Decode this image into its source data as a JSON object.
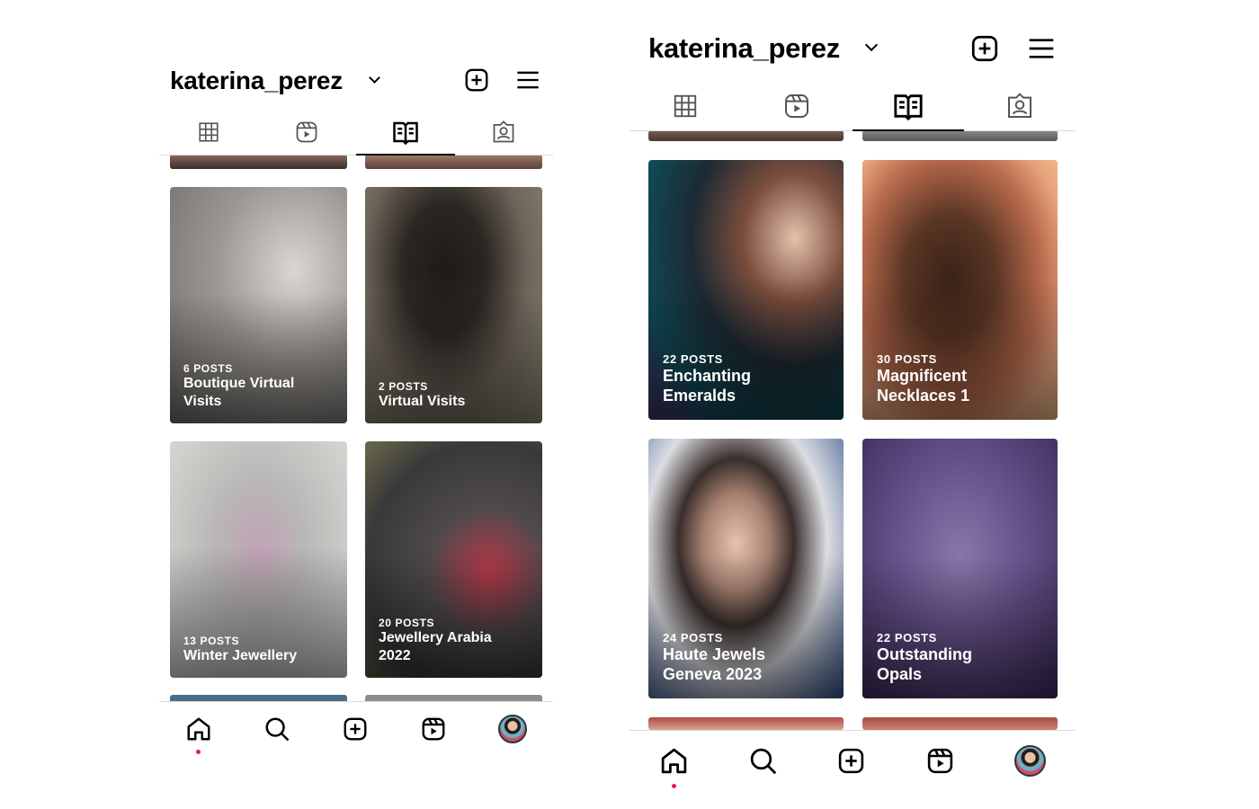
{
  "left": {
    "username": "katerina_perez",
    "active_tab": "guides",
    "guides": [
      {
        "count": "6 POSTS",
        "title": "Boutique Virtual Visits"
      },
      {
        "count": "2 POSTS",
        "title": "Virtual Visits"
      },
      {
        "count": "13 POSTS",
        "title": "Winter Jewellery"
      },
      {
        "count": "20 POSTS",
        "title": "Jewellery Arabia 2022"
      }
    ],
    "nav_active": "home"
  },
  "right": {
    "username": "katerina_perez",
    "active_tab": "guides",
    "guides": [
      {
        "count": "22 POSTS",
        "title": "Enchanting Emeralds"
      },
      {
        "count": "30 POSTS",
        "title": "Magnificent Necklaces 1"
      },
      {
        "count": "24 POSTS",
        "title": "Haute Jewels Geneva 2023"
      },
      {
        "count": "22 POSTS",
        "title": "Outstanding Opals"
      }
    ],
    "nav_active": "home"
  },
  "icons": {
    "tabs": [
      "grid-icon",
      "reels-icon",
      "guides-icon",
      "tagged-icon"
    ],
    "header": [
      "new-post-icon",
      "menu-icon"
    ],
    "nav": [
      "home-icon",
      "search-icon",
      "create-icon",
      "reels-icon",
      "profile-avatar"
    ]
  },
  "colors": {
    "notification_dot": "#ed1653",
    "divider": "#dbdbdb"
  }
}
